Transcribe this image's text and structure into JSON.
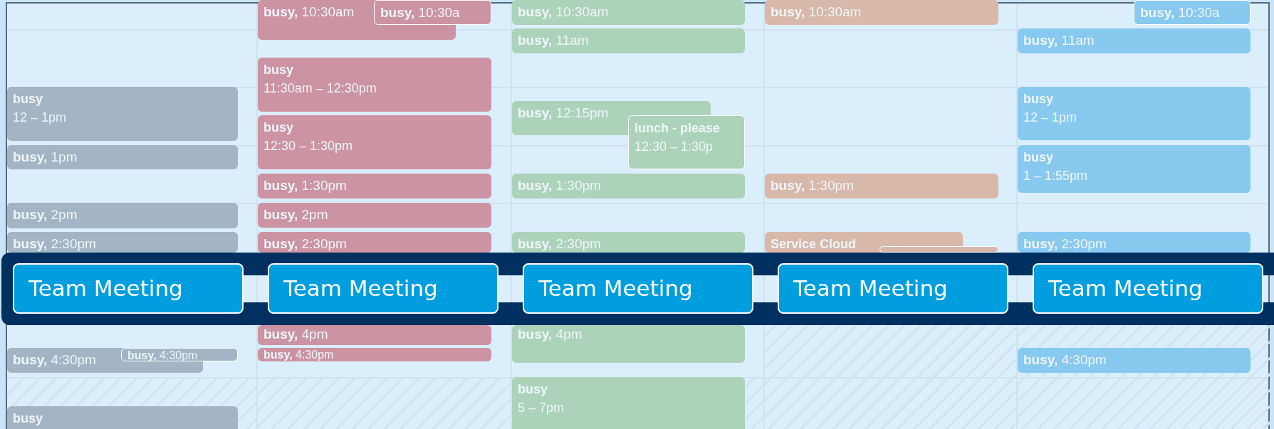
{
  "columns": [
    {
      "events": [
        {
          "kind": "double",
          "title": "busy",
          "time": "12 – 1pm",
          "color": "#a3b5c4"
        },
        {
          "kind": "single",
          "title": "busy,",
          "time": "1pm",
          "color": "#a3b5c4"
        },
        {
          "kind": "single",
          "title": "busy,",
          "time": "2pm",
          "color": "#a3b5c4"
        },
        {
          "kind": "single",
          "title": "busy,",
          "time": "2:30pm",
          "color": "#a3b5c4"
        },
        {
          "kind": "single",
          "title": "busy,",
          "time": "4:30pm",
          "color": "#a3b5c4"
        },
        {
          "kind": "small",
          "title": "busy,",
          "time": "4:30pm",
          "color": "#a3b5c4"
        },
        {
          "kind": "double",
          "title": "busy",
          "color": "#a3b5c4"
        }
      ]
    },
    {
      "events": [
        {
          "kind": "single",
          "title": "busy,",
          "time": "10:30am",
          "color": "#cc93a2"
        },
        {
          "kind": "single",
          "title": "busy,",
          "time": "10:30a",
          "color": "#cc93a2"
        },
        {
          "kind": "double",
          "title": "busy",
          "time": "11:30am – 12:30pm",
          "color": "#cc93a2"
        },
        {
          "kind": "double",
          "title": "busy",
          "time": "12:30 – 1:30pm",
          "color": "#cc93a2"
        },
        {
          "kind": "single",
          "title": "busy,",
          "time": "1:30pm",
          "color": "#cc93a2"
        },
        {
          "kind": "single",
          "title": "busy,",
          "time": "2pm",
          "color": "#cc93a2"
        },
        {
          "kind": "single",
          "title": "busy,",
          "time": "2:30pm",
          "color": "#cc93a2"
        },
        {
          "kind": "single",
          "title": "busy,",
          "time": "4pm",
          "color": "#cc93a2"
        },
        {
          "kind": "small",
          "title": "busy,",
          "time": "4:30pm",
          "color": "#cc93a2"
        }
      ]
    },
    {
      "events": [
        {
          "kind": "single",
          "title": "busy,",
          "time": "10:30am",
          "color": "#acd3b9"
        },
        {
          "kind": "single",
          "title": "busy,",
          "time": "11am",
          "color": "#acd3b9"
        },
        {
          "kind": "single",
          "title": "busy,",
          "time": "12:15pm",
          "color": "#acd3b9"
        },
        {
          "kind": "double",
          "title": "lunch - please",
          "time": "12:30 – 1:30p",
          "color": "#acd3b9"
        },
        {
          "kind": "single",
          "title": "busy,",
          "time": "1:30pm",
          "color": "#acd3b9"
        },
        {
          "kind": "single",
          "title": "busy,",
          "time": "2:30pm",
          "color": "#acd3b9"
        },
        {
          "kind": "single",
          "title": "busy,",
          "time": "4pm",
          "color": "#acd3b9"
        },
        {
          "kind": "double",
          "title": "busy",
          "time": "5 – 7pm",
          "color": "#acd3b9"
        }
      ]
    },
    {
      "events": [
        {
          "kind": "single",
          "title": "busy,",
          "time": "10:30am",
          "color": "#d8b8a8"
        },
        {
          "kind": "single",
          "title": "busy,",
          "time": "1:30pm",
          "color": "#d8b8a8"
        },
        {
          "kind": "double",
          "title": "Service Cloud",
          "color": "#d8b8a8"
        },
        {
          "kind": "blank",
          "color": "#d8b8a8"
        }
      ]
    },
    {
      "events": [
        {
          "kind": "single",
          "title": "busy,",
          "time": "10:30a",
          "color": "#88c9f0"
        },
        {
          "kind": "single",
          "title": "busy,",
          "time": "11am",
          "color": "#88c9f0"
        },
        {
          "kind": "double",
          "title": "busy",
          "time": "12 – 1pm",
          "color": "#88c9f0"
        },
        {
          "kind": "double",
          "title": "busy",
          "time": "1 – 1:55pm",
          "color": "#88c9f0"
        },
        {
          "kind": "single",
          "title": "busy,",
          "time": "2:30pm",
          "color": "#88c9f0"
        },
        {
          "kind": "single",
          "title": "busy,",
          "time": "4:30pm",
          "color": "#88c9f0"
        }
      ]
    }
  ],
  "meetings": [
    {
      "label": "Team Meeting"
    },
    {
      "label": "Team Meeting"
    },
    {
      "label": "Team Meeting"
    },
    {
      "label": "Team Meeting"
    },
    {
      "label": "Team Meeting"
    }
  ]
}
